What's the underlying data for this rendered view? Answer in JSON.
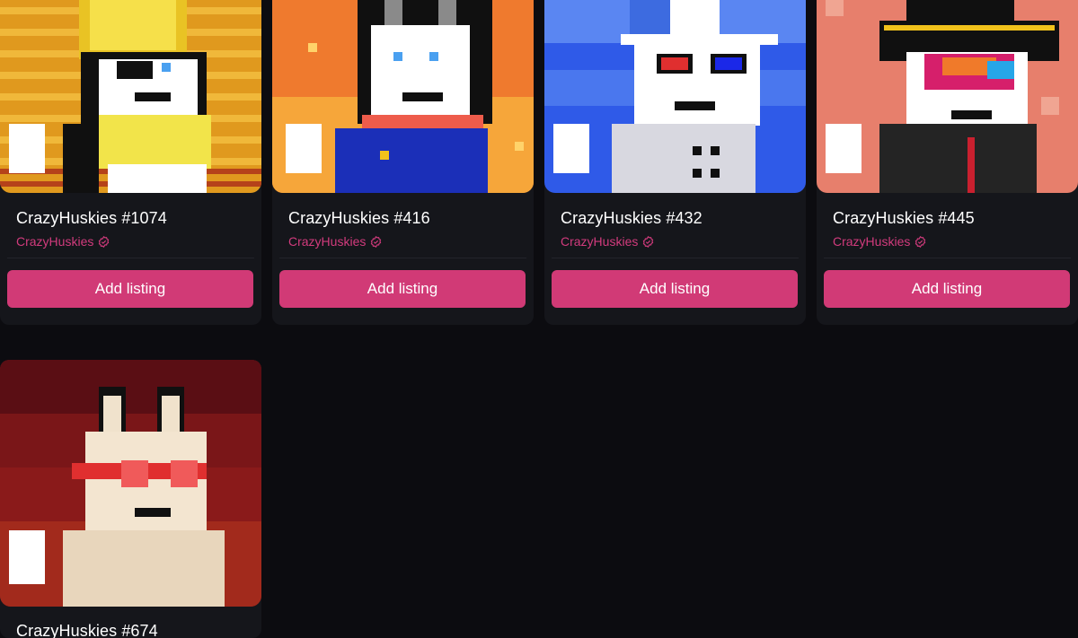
{
  "cards": [
    {
      "title": "CrazyHuskies #1074",
      "collection": "CrazyHuskies",
      "button": "Add listing"
    },
    {
      "title": "CrazyHuskies #416",
      "collection": "CrazyHuskies",
      "button": "Add listing"
    },
    {
      "title": "CrazyHuskies #432",
      "collection": "CrazyHuskies",
      "button": "Add listing"
    },
    {
      "title": "CrazyHuskies #445",
      "collection": "CrazyHuskies",
      "button": "Add listing"
    },
    {
      "title": "CrazyHuskies #674"
    }
  ],
  "colors": {
    "accent": "#d13a76",
    "collection_text": "#d23b7d",
    "card_bg": "#15161b",
    "page_bg": "#0c0c10"
  },
  "icons": {
    "verified": "verified-badge-icon"
  }
}
